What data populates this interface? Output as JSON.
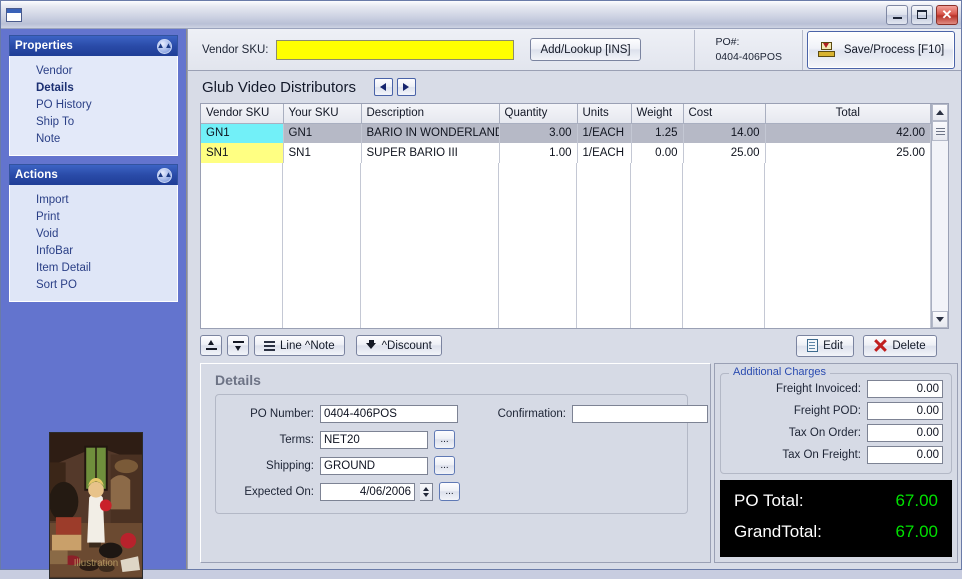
{
  "window": {
    "title": "",
    "icon": "window-icon",
    "buttons": {
      "minimize": "_",
      "maximize": "□",
      "close": "✕"
    }
  },
  "sidebar": {
    "panels": [
      {
        "title": "Properties",
        "collapse_icon": "chevron-up-icon",
        "items": [
          {
            "label": "Vendor",
            "active": false
          },
          {
            "label": "Details",
            "active": true
          },
          {
            "label": "PO History",
            "active": false
          },
          {
            "label": "Ship To",
            "active": false
          },
          {
            "label": "Note",
            "active": false
          }
        ]
      },
      {
        "title": "Actions",
        "collapse_icon": "chevron-up-icon",
        "items": [
          {
            "label": "Import",
            "active": false
          },
          {
            "label": "Print",
            "active": false
          },
          {
            "label": "Void",
            "active": false
          },
          {
            "label": "InfoBar",
            "active": false
          },
          {
            "label": "Item Detail",
            "active": false
          },
          {
            "label": "Sort PO",
            "active": false
          }
        ]
      }
    ],
    "thumbnail_alt": "girl-in-attic-thumbnail",
    "background_color": "#6374ce"
  },
  "topbar": {
    "sku_label": "Vendor SKU:",
    "sku_value": "",
    "sku_placeholder": "",
    "sku_field_color": "#ffff00",
    "add_lookup_label": "Add/Lookup [INS]",
    "po_caption": "PO#:",
    "po_number": "0404-406POS",
    "save_label": "Save/Process [F10]",
    "save_icon": "save-disk-icon"
  },
  "vendor": {
    "name": "Glub Video Distributors",
    "prev_icon": "arrow-left-icon",
    "next_icon": "arrow-right-icon"
  },
  "grid": {
    "columns": [
      {
        "label": "Vendor SKU",
        "align": "left"
      },
      {
        "label": "Your SKU",
        "align": "left"
      },
      {
        "label": "Description",
        "align": "left"
      },
      {
        "label": "Quantity",
        "align": "right"
      },
      {
        "label": "Units",
        "align": "left"
      },
      {
        "label": "Weight",
        "align": "right"
      },
      {
        "label": "Cost",
        "align": "right"
      },
      {
        "label": "Total",
        "align": "right"
      }
    ],
    "rows": [
      {
        "vendor_sku": "GN1",
        "your_sku": "GN1",
        "description": "BARIO IN WONDERLAND",
        "quantity": "3.00",
        "units": "1/EACH",
        "weight": "1.25",
        "cost": "14.00",
        "total": "42.00",
        "selected": true,
        "sku_highlight": "#72f0f8"
      },
      {
        "vendor_sku": "SN1",
        "your_sku": "SN1",
        "description": "SUPER BARIO III",
        "quantity": "1.00",
        "units": "1/EACH",
        "weight": "0.00",
        "cost": "25.00",
        "total": "25.00",
        "selected": false,
        "sku_highlight": "#ffff82"
      }
    ],
    "scrollbar": {
      "up_icon": "caret-up-icon",
      "down_icon": "caret-down-icon",
      "thumb": "scroll-thumb"
    }
  },
  "linebar": {
    "move_up_icon": "move-up-icon",
    "move_down_icon": "move-down-icon",
    "line_note_label": "Line ^Note",
    "line_note_icon": "lines-icon",
    "discount_label": "^Discount",
    "discount_icon": "down-arrow-icon",
    "edit_label": "Edit",
    "edit_icon": "document-icon",
    "delete_label": "Delete",
    "delete_icon": "red-x-icon"
  },
  "details": {
    "title": "Details",
    "po_number_label": "PO Number:",
    "po_number_value": "0404-406POS",
    "terms_label": "Terms:",
    "terms_value": "NET20",
    "shipping_label": "Shipping:",
    "shipping_value": "GROUND",
    "expected_on_label": "Expected On:",
    "expected_on_value": "4/06/2006",
    "confirmation_label": "Confirmation:",
    "confirmation_value": "",
    "browse_label": "..."
  },
  "charges": {
    "legend": "Additional Charges",
    "rows": [
      {
        "label": "Freight Invoiced:",
        "value": "0.00"
      },
      {
        "label": "Freight POD:",
        "value": "0.00"
      },
      {
        "label": "Tax On Order:",
        "value": "0.00"
      },
      {
        "label": "Tax On Freight:",
        "value": "0.00"
      }
    ]
  },
  "totals": {
    "po_total_label": "PO Total:",
    "po_total_value": "67.00",
    "grand_total_label": "GrandTotal:",
    "grand_total_value": "67.00",
    "value_color": "#00e000"
  }
}
